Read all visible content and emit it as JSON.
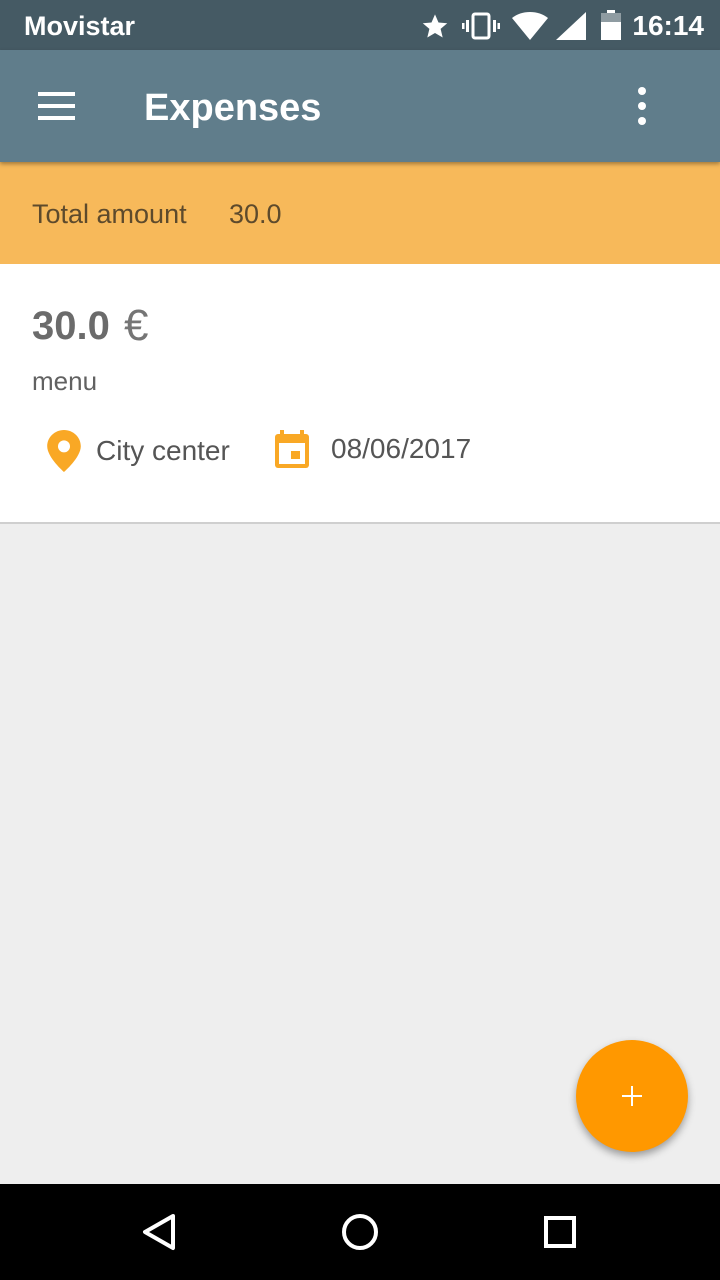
{
  "status_bar": {
    "carrier": "Movistar",
    "time": "16:14",
    "icons": [
      "star-icon",
      "vibrate-icon",
      "wifi-icon",
      "signal-icon",
      "battery-icon"
    ]
  },
  "app_bar": {
    "title": "Expenses",
    "icons": [
      "menu-icon",
      "more-vert-icon"
    ]
  },
  "total_bar": {
    "label": "Total amount",
    "value": "30.0"
  },
  "expenses": [
    {
      "amount": "30.0",
      "currency": "€",
      "description": "menu",
      "location": "City center",
      "date": "08/06/2017"
    }
  ],
  "fab": {
    "icon": "plus-icon"
  },
  "nav_bar": {
    "icons": [
      "back-icon",
      "home-icon",
      "recents-icon"
    ]
  },
  "colors": {
    "status_bar": "#455a64",
    "app_bar": "#607d8b",
    "total_bar": "#f7b95a",
    "accent": "#ff9800",
    "background": "#eeeeee"
  }
}
